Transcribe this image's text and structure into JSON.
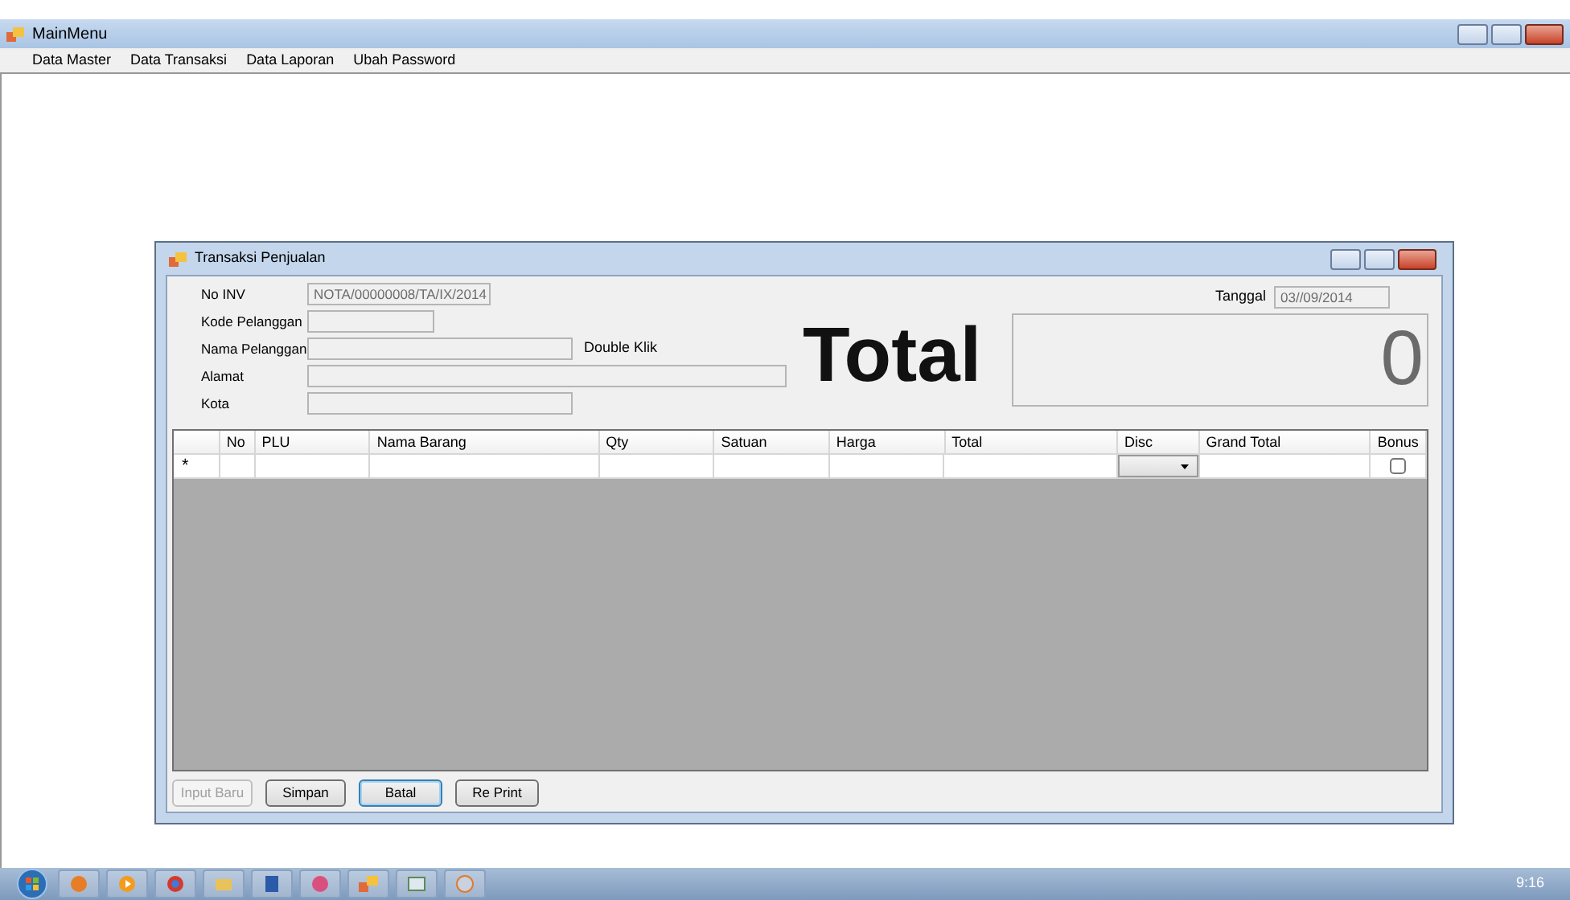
{
  "main_window": {
    "title": "MainMenu",
    "menu": [
      "Data Master",
      "Data Transaksi",
      "Data Laporan",
      "Ubah Password"
    ]
  },
  "child_window": {
    "title": "Transaksi Penjualan",
    "fields": [
      {
        "label": "No INV",
        "value": "NOTA/00000008/TA/IX/2014"
      },
      {
        "label": "Kode Pelanggan"
      },
      {
        "label": "Nama Pelanggan"
      },
      {
        "label": "Alamat"
      },
      {
        "label": "Kota"
      }
    ],
    "hint": "Double Klik",
    "date": {
      "label": "Tanggal",
      "value": "03//09/2014"
    },
    "total": {
      "label": "Total",
      "value": "0"
    },
    "grid": {
      "columns": [
        "No",
        "PLU",
        "Nama Barang",
        "Qty",
        "Satuan",
        "Harga",
        "Total",
        "Disc",
        "Grand Total",
        "Bonus"
      ],
      "new_row": {
        "marker": "*",
        "bonus_checked": false
      }
    },
    "buttons": [
      {
        "label": "Input Baru",
        "disabled": true,
        "focused": false
      },
      {
        "label": "Simpan",
        "disabled": false,
        "focused": false
      },
      {
        "label": "Batal",
        "disabled": false,
        "focused": true
      },
      {
        "label": "Re Print",
        "disabled": false,
        "focused": false
      }
    ]
  },
  "taskbar": {
    "clock": "9:16"
  }
}
